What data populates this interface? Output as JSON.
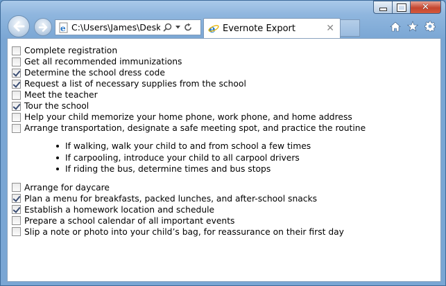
{
  "browser": {
    "address_text": "C:\\Users\\James\\Deskt",
    "tab_title": "Evernote Export",
    "tab_close": "✕",
    "close_glyph": "✕",
    "accent": "#3c7fb1"
  },
  "checklist_a": [
    {
      "label": "Complete registration",
      "checked": false
    },
    {
      "label": "Get all recommended immunizations",
      "checked": false
    },
    {
      "label": "Determine the school dress code",
      "checked": true
    },
    {
      "label": "Request a list of necessary supplies from the school",
      "checked": true
    },
    {
      "label": "Meet the teacher",
      "checked": false
    },
    {
      "label": "Tour the school",
      "checked": true
    },
    {
      "label": "Help your child memorize your home phone, work phone, and home address",
      "checked": false
    },
    {
      "label": "Arrange transportation, designate a safe meeting spot, and practice the routine",
      "checked": false
    }
  ],
  "bullets": [
    "If walking, walk your child to and from school a few times",
    "If carpooling, introduce your child to all carpool drivers",
    "If riding the bus, determine times and bus stops"
  ],
  "checklist_b": [
    {
      "label": "Arrange for daycare",
      "checked": false
    },
    {
      "label": "Plan a menu for breakfasts, packed lunches, and after-school snacks",
      "checked": true
    },
    {
      "label": "Establish a homework location and schedule",
      "checked": true
    },
    {
      "label": "Prepare a school calendar of all important events",
      "checked": false
    },
    {
      "label": "Slip a note or photo into your child’s bag, for reassurance on their first day",
      "checked": false
    }
  ]
}
